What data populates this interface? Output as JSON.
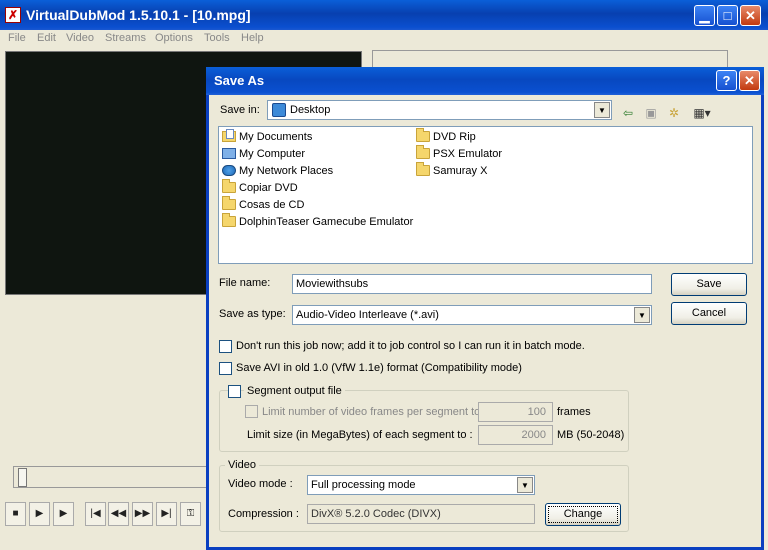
{
  "app": {
    "title": "VirtualDubMod 1.5.10.1 - [10.mpg]",
    "menu": [
      "File",
      "Edit",
      "Video",
      "Streams",
      "Options",
      "Tools",
      "Help"
    ]
  },
  "dialog": {
    "title": "Save As",
    "save_in_label": "Save in:",
    "save_in_value": "Desktop",
    "files": [
      {
        "name": "My Documents",
        "icon": "my-documents-icon"
      },
      {
        "name": "My Computer",
        "icon": "computer-icon"
      },
      {
        "name": "My Network Places",
        "icon": "network-places-icon"
      },
      {
        "name": "Copiar DVD",
        "icon": "folder-icon"
      },
      {
        "name": "Cosas de CD",
        "icon": "folder-icon"
      },
      {
        "name": "DolphinTeaser Gamecube Emulator",
        "icon": "folder-icon"
      },
      {
        "name": "DVD Rip",
        "icon": "folder-icon"
      },
      {
        "name": "PSX Emulator",
        "icon": "folder-icon"
      },
      {
        "name": "Samuray X",
        "icon": "folder-icon"
      }
    ],
    "file_name_label": "File name:",
    "file_name_value": "Moviewithsubs",
    "save_as_type_label": "Save as type:",
    "save_as_type_value": "Audio-Video Interleave (*.avi)",
    "save_button": "Save",
    "cancel_button": "Cancel",
    "option_job": "Don't run this job now; add it to job control so I can run it in batch mode.",
    "option_old_avi": "Save AVI in old 1.0 (VfW 1.1e) format (Compatibility mode)",
    "segment": {
      "title": "Segment output file",
      "limit_frames_label": "Limit number of video frames per segment to",
      "limit_frames_value": "100",
      "limit_frames_unit": "frames",
      "limit_size_label": "Limit size (in MegaBytes) of each segment to :",
      "limit_size_value": "2000",
      "limit_size_unit": "MB (50-2048)"
    },
    "video": {
      "title": "Video",
      "mode_label": "Video mode :",
      "mode_value": "Full processing mode",
      "compression_label": "Compression :",
      "compression_value": "DivX® 5.2.0 Codec (DIVX)",
      "change_button": "Change"
    }
  }
}
